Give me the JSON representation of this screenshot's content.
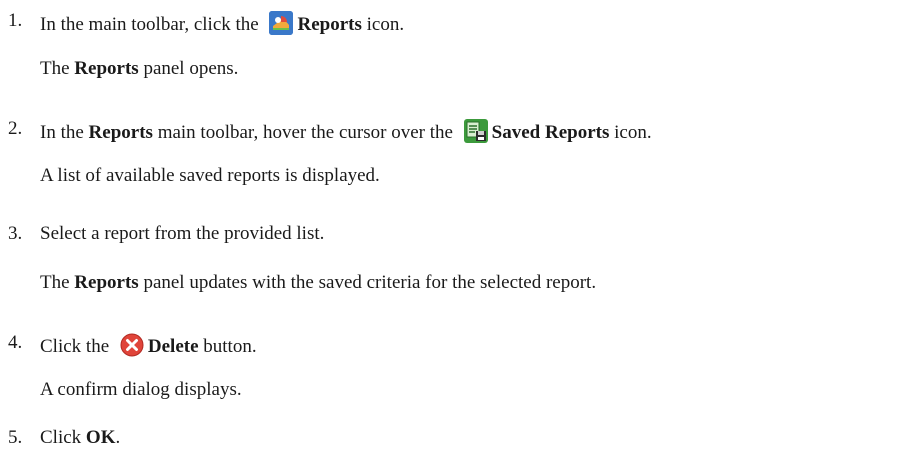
{
  "steps": [
    {
      "number": "1.",
      "before": "In the main toolbar, click the ",
      "icon": "reports-icon",
      "bold": "Reports",
      "after": " icon.",
      "result": {
        "bold": "Reports",
        "text": " panel opens.",
        "prefix": "The "
      }
    },
    {
      "number": "2.",
      "before": "In the ",
      "bold1": "Reports",
      "middle": " main toolbar, hover the cursor over the ",
      "icon": "saved-reports-icon",
      "bold": "Saved Reports",
      "after": " icon.",
      "result": {
        "text": "A list of available saved reports is displayed."
      }
    },
    {
      "number": "3.",
      "text": "Select a report from the provided list.",
      "result": {
        "prefix": "The ",
        "bold": "Reports",
        "text": " panel updates with the saved criteria for the selected report."
      }
    },
    {
      "number": "4.",
      "before": "Click the ",
      "icon": "delete-icon",
      "bold": "Delete",
      "after": " button.",
      "result": {
        "text": "A confirm dialog displays."
      }
    },
    {
      "number": "5.",
      "before": "Click ",
      "bold": "OK",
      "after": "."
    }
  ],
  "colors": {
    "text": "#1a1a1a",
    "reports_icon_bg": "#3a78c9",
    "saved_reports_icon_bg": "#3c9a3c",
    "delete_icon": "#e0443a"
  }
}
